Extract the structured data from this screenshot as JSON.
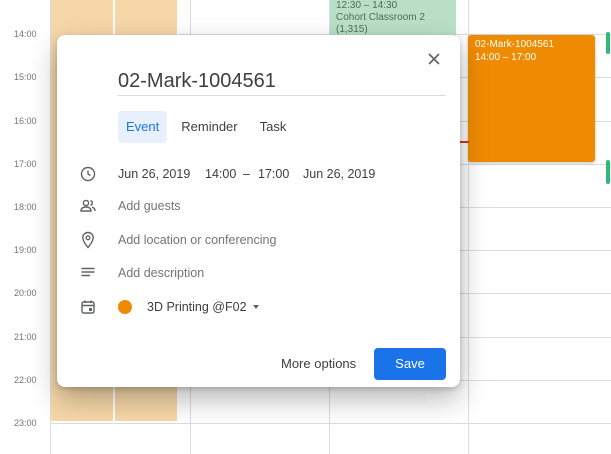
{
  "calendar": {
    "times": [
      "14:00",
      "15:00",
      "16:00",
      "17:00",
      "18:00",
      "19:00",
      "20:00",
      "21:00",
      "22:00",
      "23:00"
    ],
    "green_event": {
      "time": "12:30 – 14:30",
      "title": "Cohort Classroom 2",
      "sub": "(1,315)"
    },
    "orange_event": {
      "title": "02-Mark-1004561",
      "time": "14:00 – 17:00"
    },
    "colors": {
      "peach": "#f6d7a8",
      "green": "#b9e0c6",
      "orange": "#ef8b00",
      "now_line": "#d93025"
    }
  },
  "dialog": {
    "title": "02-Mark-1004561",
    "tabs": [
      {
        "label": "Event",
        "active": true
      },
      {
        "label": "Reminder",
        "active": false
      },
      {
        "label": "Task",
        "active": false
      }
    ],
    "datetime": {
      "start_date": "Jun 26, 2019",
      "start_time": "14:00",
      "dash": "–",
      "end_time": "17:00",
      "end_date": "Jun 26, 2019"
    },
    "guests_placeholder": "Add guests",
    "location_placeholder": "Add location or conferencing",
    "description_placeholder": "Add description",
    "calendar_name": "3D Printing @F02",
    "more_options_label": "More options",
    "save_label": "Save",
    "icons": [
      "close-icon",
      "clock-icon",
      "people-icon",
      "location-pin-icon",
      "notes-icon",
      "calendar-icon",
      "dropdown-caret-icon"
    ],
    "accent": "#1a73e8"
  }
}
